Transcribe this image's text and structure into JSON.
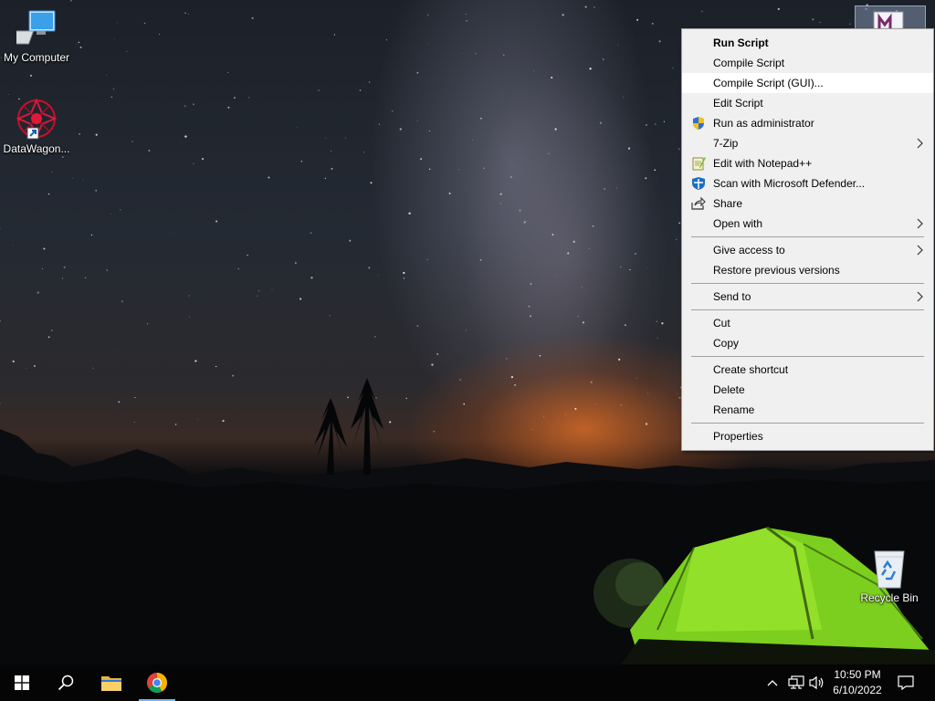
{
  "desktop": {
    "icons": [
      {
        "label": "My Computer",
        "icon": "computer-icon"
      },
      {
        "label": "DataWagon...",
        "icon": "datawagon-icon"
      },
      {
        "label": "Recycle Bin",
        "icon": "recycle-bin-icon"
      }
    ]
  },
  "context_menu": {
    "items": [
      {
        "label": "Run Script",
        "bold": true
      },
      {
        "label": "Compile Script"
      },
      {
        "label": "Compile Script (GUI)...",
        "hover": true
      },
      {
        "label": "Edit Script"
      },
      {
        "label": "Run as administrator",
        "icon": "uac-shield-icon"
      },
      {
        "label": "7-Zip",
        "submenu": true
      },
      {
        "label": "Edit with Notepad++",
        "icon": "notepadpp-icon"
      },
      {
        "label": "Scan with Microsoft Defender...",
        "icon": "defender-icon"
      },
      {
        "label": "Share",
        "icon": "share-icon"
      },
      {
        "label": "Open with",
        "submenu": true
      },
      {
        "label": "Give access to",
        "submenu": true
      },
      {
        "label": "Restore previous versions"
      },
      {
        "label": "Send to",
        "submenu": true
      },
      {
        "label": "Cut"
      },
      {
        "label": "Copy"
      },
      {
        "label": "Create shortcut"
      },
      {
        "label": "Delete"
      },
      {
        "label": "Rename"
      },
      {
        "label": "Properties"
      }
    ]
  },
  "taskbar": {
    "buttons": [
      {
        "name": "start",
        "icon": "windows-logo-icon"
      },
      {
        "name": "search",
        "icon": "search-icon"
      },
      {
        "name": "file-explorer",
        "icon": "folder-icon"
      },
      {
        "name": "chrome",
        "icon": "chrome-icon",
        "active": true
      }
    ],
    "tray": {
      "icons": [
        "chevron-up-icon",
        "network-icon",
        "volume-icon",
        "notification-icon"
      ],
      "time": "10:50 PM",
      "date": "6/10/2022"
    }
  },
  "colors": {
    "menu_bg": "#f0f0f0",
    "menu_hover": "#ffffff",
    "taskbar": "#050506",
    "taskbar_active": "#76b9ed"
  }
}
